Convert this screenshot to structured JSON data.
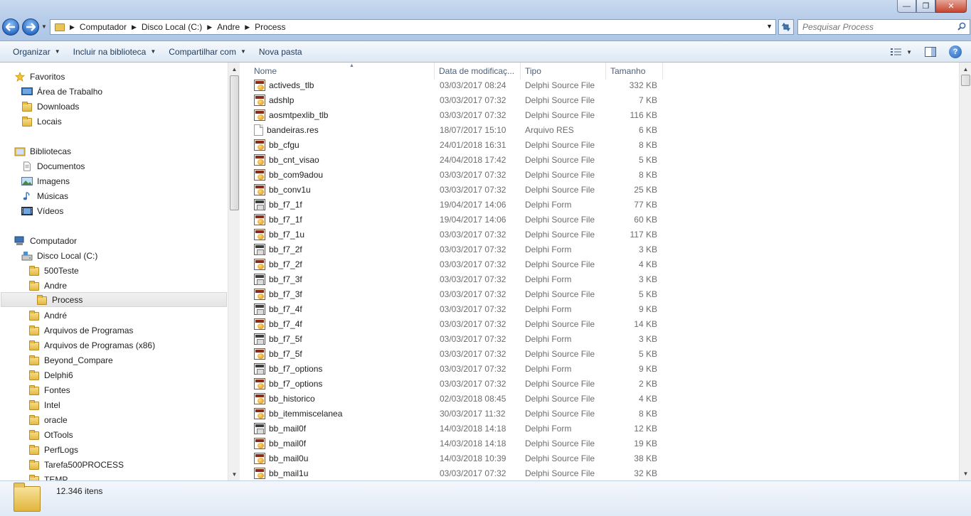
{
  "window": {
    "minimize_glyph": "—",
    "maximize_glyph": "❐",
    "close_glyph": "✕"
  },
  "address": {
    "crumbs": [
      "Computador",
      "Disco Local (C:)",
      "Andre",
      "Process"
    ]
  },
  "search": {
    "placeholder": "Pesquisar Process"
  },
  "toolbar": {
    "organize": "Organizar",
    "include_library": "Incluir na biblioteca",
    "share_with": "Compartilhar com",
    "new_folder": "Nova pasta",
    "help_glyph": "?"
  },
  "nav": {
    "favorites": "Favoritos",
    "desktop": "Área de Trabalho",
    "downloads": "Downloads",
    "places": "Locais",
    "libraries": "Bibliotecas",
    "documents": "Documentos",
    "images": "Imagens",
    "music": "Músicas",
    "videos": "Vídeos",
    "computer": "Computador",
    "local_disk": "Disco Local (C:)",
    "folders": [
      "500Teste",
      "Andre",
      "Process",
      "André",
      "Arquivos de Programas",
      "Arquivos de Programas (x86)",
      "Beyond_Compare",
      "Delphi6",
      "Fontes",
      "Intel",
      "oracle",
      "OtTools",
      "PerfLogs",
      "Tarefa500PROCESS",
      "TEMP"
    ]
  },
  "columns": {
    "name": "Nome",
    "date": "Data de modificaç...",
    "type": "Tipo",
    "size": "Tamanho"
  },
  "files": [
    {
      "name": "activeds_tlb",
      "date": "03/03/2017 08:24",
      "type": "Delphi Source File",
      "size": "332 KB",
      "icon": "pas"
    },
    {
      "name": "adshlp",
      "date": "03/03/2017 07:32",
      "type": "Delphi Source File",
      "size": "7 KB",
      "icon": "pas"
    },
    {
      "name": "aosmtpexlib_tlb",
      "date": "03/03/2017 07:32",
      "type": "Delphi Source File",
      "size": "116 KB",
      "icon": "pas"
    },
    {
      "name": "bandeiras.res",
      "date": "18/07/2017 15:10",
      "type": "Arquivo RES",
      "size": "6 KB",
      "icon": "res"
    },
    {
      "name": "bb_cfgu",
      "date": "24/01/2018 16:31",
      "type": "Delphi Source File",
      "size": "8 KB",
      "icon": "pas"
    },
    {
      "name": "bb_cnt_visao",
      "date": "24/04/2018 17:42",
      "type": "Delphi Source File",
      "size": "5 KB",
      "icon": "pas"
    },
    {
      "name": "bb_com9adou",
      "date": "03/03/2017 07:32",
      "type": "Delphi Source File",
      "size": "8 KB",
      "icon": "pas"
    },
    {
      "name": "bb_conv1u",
      "date": "03/03/2017 07:32",
      "type": "Delphi Source File",
      "size": "25 KB",
      "icon": "pas"
    },
    {
      "name": "bb_f7_1f",
      "date": "19/04/2017 14:06",
      "type": "Delphi Form",
      "size": "77 KB",
      "icon": "dfm"
    },
    {
      "name": "bb_f7_1f",
      "date": "19/04/2017 14:06",
      "type": "Delphi Source File",
      "size": "60 KB",
      "icon": "pas"
    },
    {
      "name": "bb_f7_1u",
      "date": "03/03/2017 07:32",
      "type": "Delphi Source File",
      "size": "117 KB",
      "icon": "pas"
    },
    {
      "name": "bb_f7_2f",
      "date": "03/03/2017 07:32",
      "type": "Delphi Form",
      "size": "3 KB",
      "icon": "dfm"
    },
    {
      "name": "bb_f7_2f",
      "date": "03/03/2017 07:32",
      "type": "Delphi Source File",
      "size": "4 KB",
      "icon": "pas"
    },
    {
      "name": "bb_f7_3f",
      "date": "03/03/2017 07:32",
      "type": "Delphi Form",
      "size": "3 KB",
      "icon": "dfm"
    },
    {
      "name": "bb_f7_3f",
      "date": "03/03/2017 07:32",
      "type": "Delphi Source File",
      "size": "5 KB",
      "icon": "pas"
    },
    {
      "name": "bb_f7_4f",
      "date": "03/03/2017 07:32",
      "type": "Delphi Form",
      "size": "9 KB",
      "icon": "dfm"
    },
    {
      "name": "bb_f7_4f",
      "date": "03/03/2017 07:32",
      "type": "Delphi Source File",
      "size": "14 KB",
      "icon": "pas"
    },
    {
      "name": "bb_f7_5f",
      "date": "03/03/2017 07:32",
      "type": "Delphi Form",
      "size": "3 KB",
      "icon": "dfm"
    },
    {
      "name": "bb_f7_5f",
      "date": "03/03/2017 07:32",
      "type": "Delphi Source File",
      "size": "5 KB",
      "icon": "pas"
    },
    {
      "name": "bb_f7_options",
      "date": "03/03/2017 07:32",
      "type": "Delphi Form",
      "size": "9 KB",
      "icon": "dfm"
    },
    {
      "name": "bb_f7_options",
      "date": "03/03/2017 07:32",
      "type": "Delphi Source File",
      "size": "2 KB",
      "icon": "pas"
    },
    {
      "name": "bb_historico",
      "date": "02/03/2018 08:45",
      "type": "Delphi Source File",
      "size": "4 KB",
      "icon": "pas"
    },
    {
      "name": "bb_itemmiscelanea",
      "date": "30/03/2017 11:32",
      "type": "Delphi Source File",
      "size": "8 KB",
      "icon": "pas"
    },
    {
      "name": "bb_mail0f",
      "date": "14/03/2018 14:18",
      "type": "Delphi Form",
      "size": "12 KB",
      "icon": "dfm"
    },
    {
      "name": "bb_mail0f",
      "date": "14/03/2018 14:18",
      "type": "Delphi Source File",
      "size": "19 KB",
      "icon": "pas"
    },
    {
      "name": "bb_mail0u",
      "date": "14/03/2018 10:39",
      "type": "Delphi Source File",
      "size": "38 KB",
      "icon": "pas"
    },
    {
      "name": "bb_mail1u",
      "date": "03/03/2017 07:32",
      "type": "Delphi Source File",
      "size": "32 KB",
      "icon": "pas"
    }
  ],
  "status": {
    "count": "12.346 itens"
  }
}
